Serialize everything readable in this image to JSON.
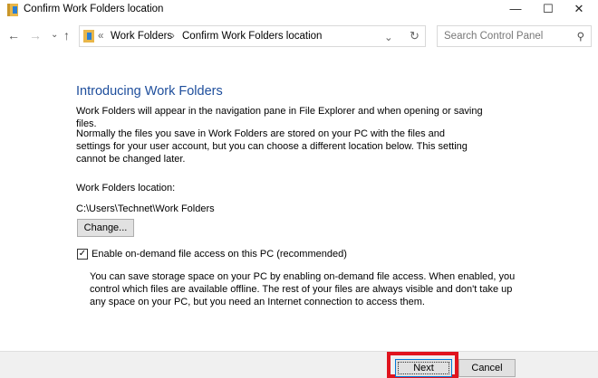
{
  "window": {
    "title": "Confirm Work Folders location",
    "minimize": "—",
    "maximize": "☐",
    "close": "✕"
  },
  "nav": {
    "back": "←",
    "forward": "→",
    "recent": "⌄",
    "up": "↑",
    "refresh": "↻",
    "dropdown": "⌄"
  },
  "address": {
    "overflow": "«",
    "crumbs": [
      "Work Folders",
      "Confirm Work Folders location"
    ],
    "sep": "›"
  },
  "search": {
    "placeholder": "Search Control Panel",
    "icon": "⚲"
  },
  "content": {
    "heading": "Introducing Work Folders",
    "intro": "Work Folders will appear in the navigation pane in File Explorer and when opening or saving files.",
    "normally": "Normally the files you save in Work Folders are stored on your PC with the files and settings for your user account, but you can choose a different location below. This setting cannot be changed later.",
    "location_label": "Work Folders location:",
    "location_value": "C:\\Users\\Technet\\Work Folders",
    "change_button": "Change...",
    "ondemand_label": "Enable on-demand file access on this PC (recommended)",
    "ondemand_checked": true,
    "ondemand_desc": "You can save storage space on your PC by enabling on-demand file access. When enabled, you control which files are available offline. The rest of your files are always visible and don't take up any space on your PC, but you need an Internet connection to access them."
  },
  "footer": {
    "next": "Next",
    "cancel": "Cancel"
  },
  "colors": {
    "heading": "#1e4e9c",
    "highlight": "#e0141e"
  }
}
